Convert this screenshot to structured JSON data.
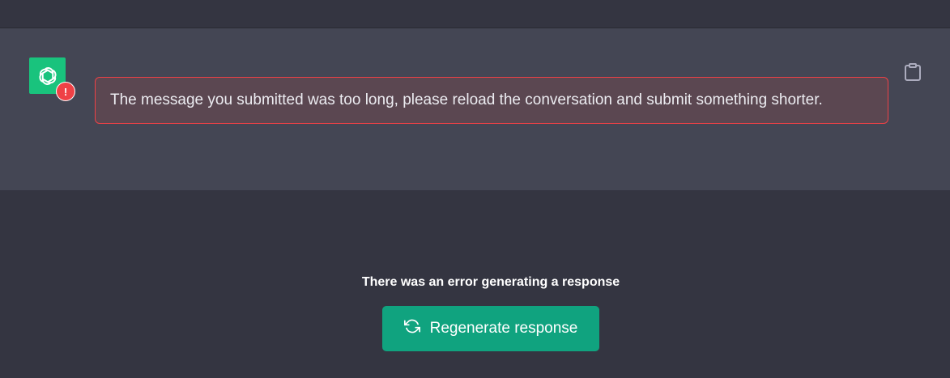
{
  "message": {
    "error_text": "The message you submitted was too long, please reload the conversation and submit something shorter.",
    "avatar_icon": "openai-logo-icon",
    "status_icon": "error-exclamation-icon",
    "status_glyph": "!",
    "copy_icon": "clipboard-icon"
  },
  "footer": {
    "error_notice": "There was an error generating a response",
    "regenerate_label": "Regenerate response",
    "regenerate_icon": "refresh-icon"
  },
  "colors": {
    "background": "#343541",
    "assistant_row": "#444654",
    "accent": "#10a37f",
    "avatar": "#19c37d",
    "error": "#ef4146"
  }
}
